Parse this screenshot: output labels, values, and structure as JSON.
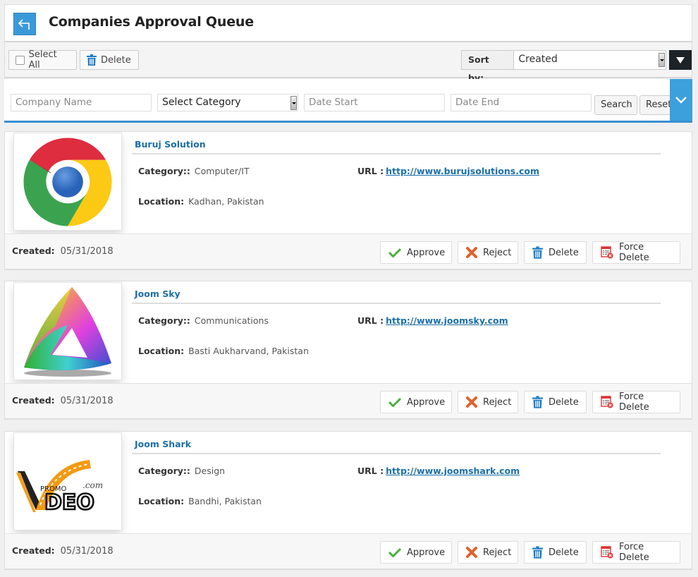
{
  "header": {
    "title": "Companies Approval Queue",
    "back_icon": "back-arrow-icon"
  },
  "toolbar": {
    "select_all_label": "Select All",
    "delete_label": "Delete",
    "sort_label": "Sort by:",
    "sort_value": "Created",
    "sort_direction_icon": "caret-down-icon"
  },
  "filters": {
    "company_name_placeholder": "Company Name",
    "category_value": "Select Category",
    "date_start_placeholder": "Date Start",
    "date_end_placeholder": "Date End",
    "search_label": "Search",
    "reset_label": "Reset",
    "expand_icon": "chevron-down-icon"
  },
  "labels": {
    "category": "Category::",
    "url": "URL :",
    "location": "Location:",
    "created": "Created:",
    "approve": "Approve",
    "reject": "Reject",
    "delete": "Delete",
    "force_delete": "Force Delete"
  },
  "companies": [
    {
      "name": "Buruj Solution",
      "category": "Computer/IT",
      "url": "http://www.burujsolutions.com",
      "location": "Kadhan, Pakistan",
      "created": "05/31/2018",
      "logo": "chrome-logo"
    },
    {
      "name": "Joom Sky",
      "category": "Communications",
      "url": "http://www.joomsky.com",
      "location": "Basti Aukharvand, Pakistan",
      "created": "05/31/2018",
      "logo": "rainbow-triangle-logo"
    },
    {
      "name": "Joom Shark",
      "category": "Design",
      "url": "http://www.joomshark.com",
      "location": "Bandhi, Pakistan",
      "created": "05/31/2018",
      "logo": "promo-video-logo"
    }
  ],
  "promo_logo_text": {
    "promo": "PROMO",
    "dotcom": ".com",
    "video": "DEO"
  },
  "colors": {
    "accent": "#3a9ad9",
    "link": "#1b6fa8",
    "sort_dir_bg": "#1d2226"
  }
}
